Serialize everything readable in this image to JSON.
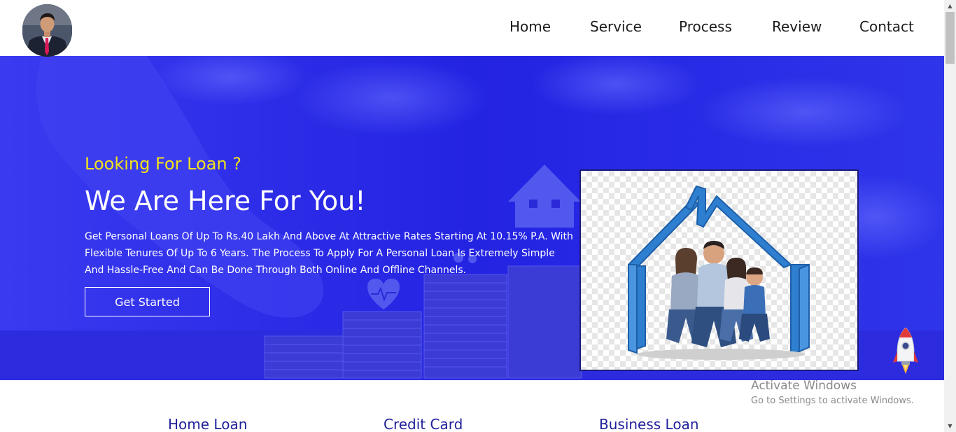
{
  "header": {
    "nav": [
      "Home",
      "Service",
      "Process",
      "Review",
      "Contact"
    ]
  },
  "hero": {
    "tagline": "Looking For Loan ?",
    "headline": "We Are Here For You!",
    "description": "Get Personal Loans Of Up To Rs.40 Lakh And Above At Attractive Rates Starting At 10.15% P.A. With Flexible Tenures Of Up To 6 Years. The Process To Apply For A Personal Loan Is Extremely Simple And Hassle-Free And Can Be Done Through Both Online And Offline Channels.",
    "cta_label": "Get Started"
  },
  "services": [
    "Home Loan",
    "Credit Card",
    "Business Loan"
  ],
  "watermark": {
    "title": "Activate Windows",
    "subtitle": "Go to Settings to activate Windows."
  },
  "colors": {
    "hero_bg": "#2525e6",
    "tagline": "#f2e21b",
    "service_title": "#1f1f9a"
  },
  "icons": {
    "avatar": "profile-photo",
    "image": "family-house-illustration",
    "back_to_top": "rocket-icon"
  }
}
